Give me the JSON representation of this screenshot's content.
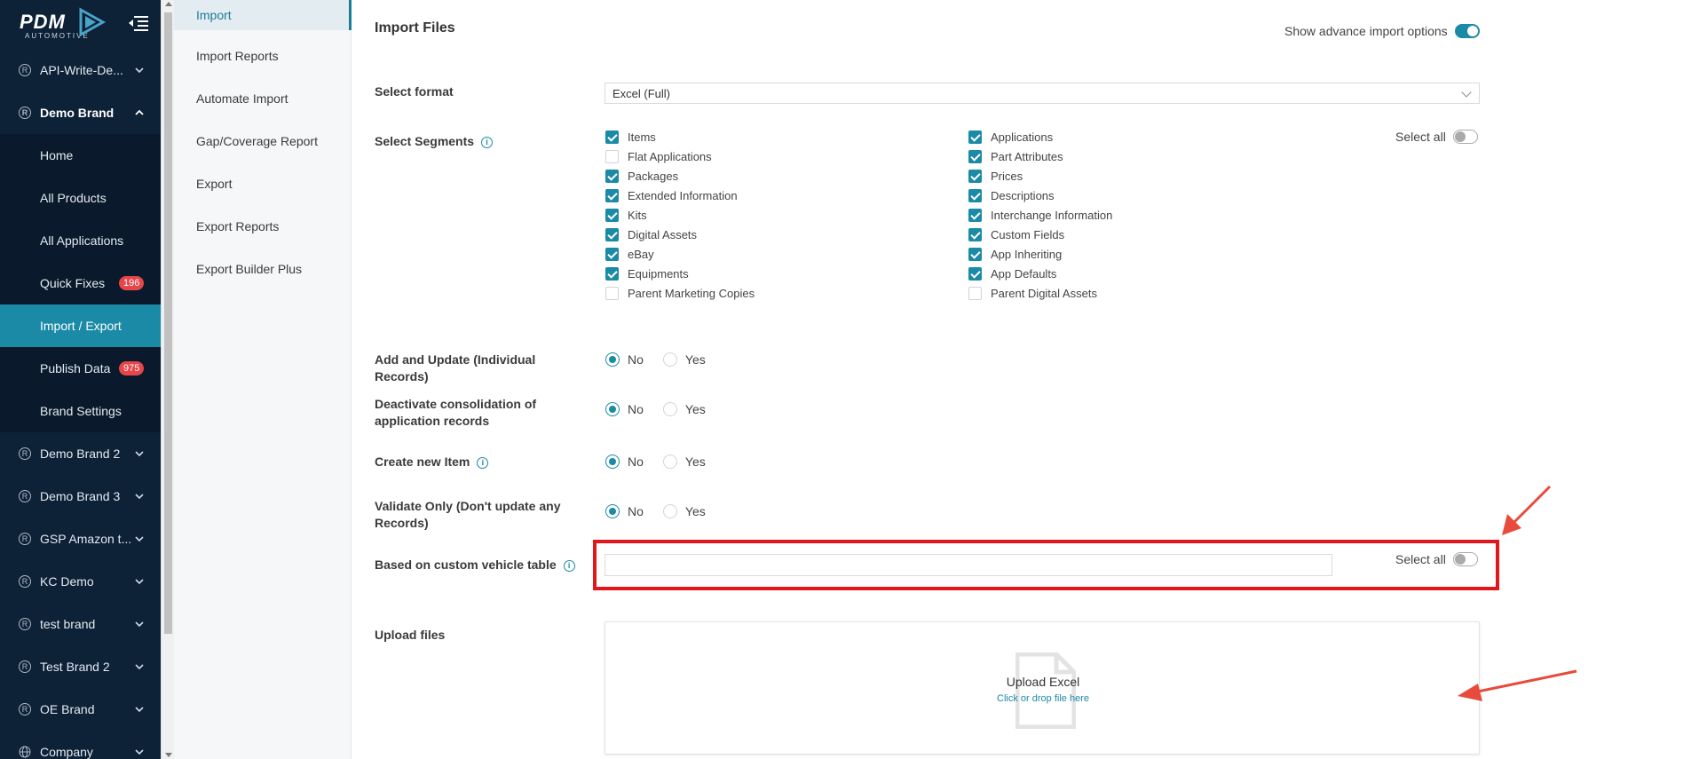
{
  "brand": {
    "logo_text": "PDM",
    "logo_sub": "AUTOMOTIVE"
  },
  "nav": {
    "brands": [
      {
        "label": "API-Write-De..."
      },
      {
        "label": "Demo Brand"
      },
      {
        "label": "Demo Brand 2"
      },
      {
        "label": "Demo Brand 3"
      },
      {
        "label": "GSP Amazon t..."
      },
      {
        "label": "KC Demo"
      },
      {
        "label": "test brand"
      },
      {
        "label": "Test Brand 2"
      },
      {
        "label": "OE Brand"
      },
      {
        "label": "Company"
      }
    ],
    "sub_items": [
      {
        "label": "Home"
      },
      {
        "label": "All Products"
      },
      {
        "label": "All Applications"
      },
      {
        "label": "Quick Fixes",
        "badge": "196"
      },
      {
        "label": "Import / Export"
      },
      {
        "label": "Publish Data",
        "badge": "975"
      },
      {
        "label": "Brand Settings"
      }
    ]
  },
  "submenu": {
    "items": [
      {
        "label": "Import"
      },
      {
        "label": "Import Reports"
      },
      {
        "label": "Automate Import"
      },
      {
        "label": "Gap/Coverage Report"
      },
      {
        "label": "Export"
      },
      {
        "label": "Export Reports"
      },
      {
        "label": "Export Builder Plus"
      }
    ]
  },
  "main": {
    "title": "Import Files",
    "advanced_label": "Show advance import options",
    "format_label": "Select format",
    "format_value": "Excel (Full)",
    "segments_label": "Select Segments",
    "select_all_label": "Select all",
    "segments_left": [
      {
        "label": "Items",
        "checked": true
      },
      {
        "label": "Flat Applications",
        "checked": false
      },
      {
        "label": "Packages",
        "checked": true
      },
      {
        "label": "Extended Information",
        "checked": true
      },
      {
        "label": "Kits",
        "checked": true
      },
      {
        "label": "Digital Assets",
        "checked": true
      },
      {
        "label": "eBay",
        "checked": true
      },
      {
        "label": "Equipments",
        "checked": true
      },
      {
        "label": "Parent Marketing Copies",
        "checked": false
      }
    ],
    "segments_right": [
      {
        "label": "Applications",
        "checked": true
      },
      {
        "label": "Part Attributes",
        "checked": true
      },
      {
        "label": "Prices",
        "checked": true
      },
      {
        "label": "Descriptions",
        "checked": true
      },
      {
        "label": "Interchange Information",
        "checked": true
      },
      {
        "label": "Custom Fields",
        "checked": true
      },
      {
        "label": "App Inheriting",
        "checked": true
      },
      {
        "label": "App Defaults",
        "checked": true
      },
      {
        "label": "Parent Digital Assets",
        "checked": false
      }
    ],
    "options": [
      {
        "label": "Add and Update (Individual Records)",
        "selected": "No"
      },
      {
        "label": "Deactivate consolidation of application records",
        "selected": "No"
      },
      {
        "label": "Create new Item",
        "selected": "No"
      },
      {
        "label": "Validate Only (Don't update any Records)",
        "selected": "No"
      }
    ],
    "radio_no": "No",
    "radio_yes": "Yes",
    "vehicle_table_label": "Based on custom vehicle table",
    "vehicle_select_all_label": "Select all",
    "upload_label": "Upload files",
    "upload_title": "Upload Excel",
    "upload_hint": "Click or drop file here"
  },
  "colors": {
    "nav_bg": "#0d2137",
    "accent": "#1b8aa6",
    "badge": "#e6454a",
    "highlight": "#e4161b"
  }
}
